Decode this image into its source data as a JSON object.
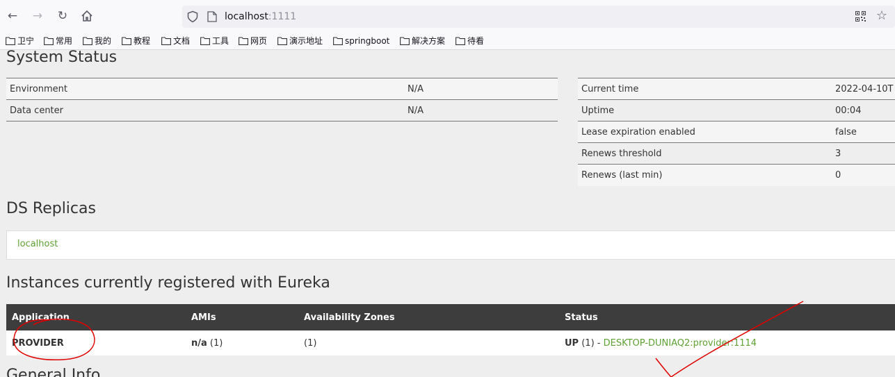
{
  "browser": {
    "url_host": "localhost",
    "url_port": ":1111",
    "bookmarks": [
      "卫宁",
      "常用",
      "我的",
      "教程",
      "文档",
      "工具",
      "网页",
      "演示地址",
      "springboot",
      "解决方案",
      "待看"
    ]
  },
  "page": {
    "system_status_title": "System Status",
    "environment_table": [
      {
        "label": "Environment",
        "value": "N/A"
      },
      {
        "label": "Data center",
        "value": "N/A"
      }
    ],
    "status_table": [
      {
        "label": "Current time",
        "value": "2022-04-10T"
      },
      {
        "label": "Uptime",
        "value": "00:04"
      },
      {
        "label": "Lease expiration enabled",
        "value": "false"
      },
      {
        "label": "Renews threshold",
        "value": "3"
      },
      {
        "label": "Renews (last min)",
        "value": "0"
      }
    ],
    "ds_replicas_title": "DS Replicas",
    "replica": "localhost",
    "instances_title": "Instances currently registered with Eureka",
    "instances_headers": [
      "Application",
      "AMIs",
      "Availability Zones",
      "Status"
    ],
    "instances_rows": [
      {
        "application": "PROVIDER",
        "amis_bold": "n/a",
        "amis_count": " (1)",
        "zones": "(1)",
        "status_bold": "UP",
        "status_count": " (1) - ",
        "status_link": "DESKTOP-DUNIAQ2:provider:1114"
      }
    ],
    "general_info_title": "General Info"
  },
  "colors": {
    "link_green": "#5fa134",
    "header_dark": "#3d3d3d",
    "annotation_red": "#e00000"
  }
}
